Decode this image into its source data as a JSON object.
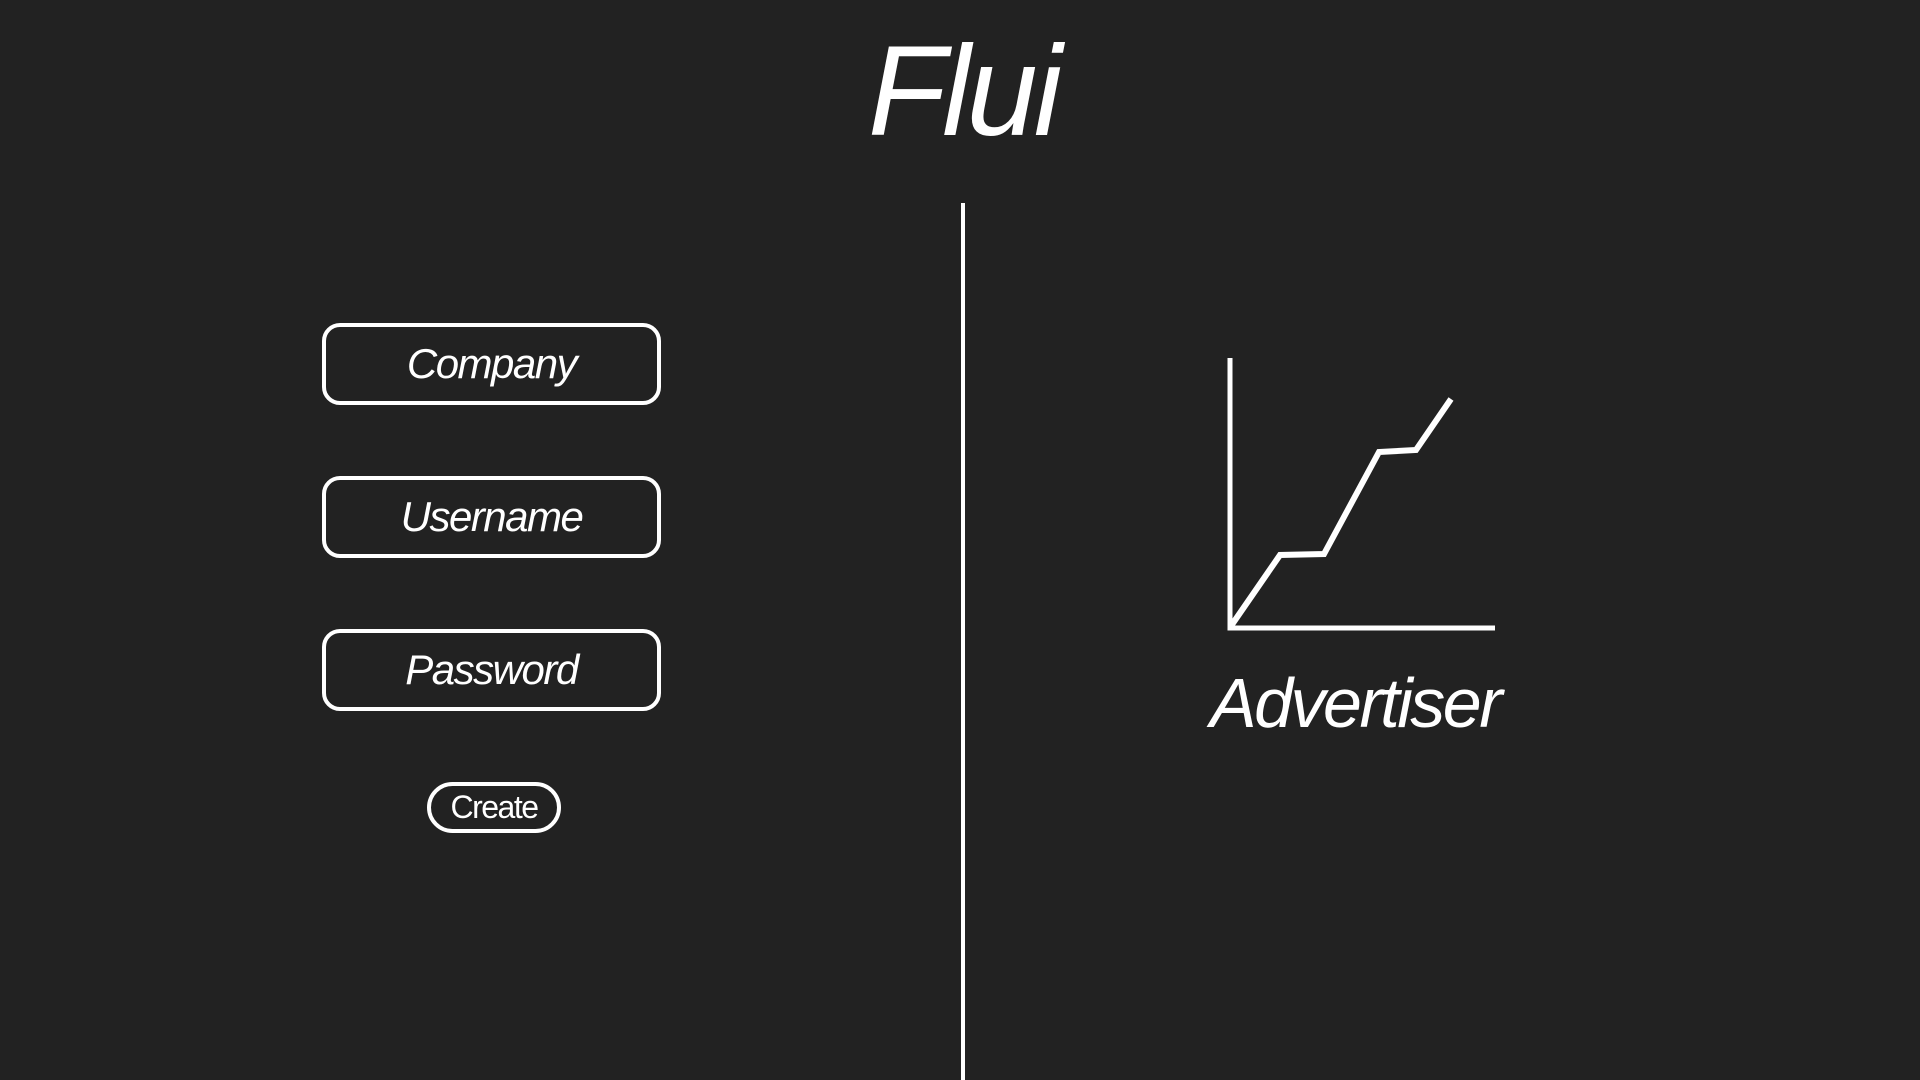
{
  "app": {
    "title": "Flui"
  },
  "form": {
    "company": {
      "placeholder": "Company",
      "value": ""
    },
    "username": {
      "placeholder": "Username",
      "value": ""
    },
    "password": {
      "placeholder": "Password",
      "value": ""
    },
    "create_label": "Create"
  },
  "account_type": {
    "label": "Advertiser",
    "icon": "line-chart-icon"
  },
  "colors": {
    "background": "#222222",
    "foreground": "#ffffff"
  }
}
